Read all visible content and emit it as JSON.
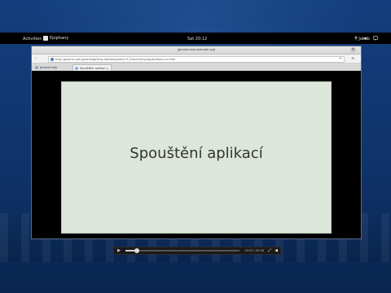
{
  "topbar": {
    "activities_label": "Activities",
    "app_name": "Epiphany",
    "clock": "Sat 20:12",
    "user_name": "Jakub"
  },
  "window": {
    "title": "(gnome-help example org)"
  },
  "browser": {
    "url": "http://gnome.com/gnome/getting-started/gnome-3.2/launching-applications-cs.html",
    "tabs": [
      {
        "label": "gnome-help"
      },
      {
        "label": "Spouštění aplikací"
      }
    ]
  },
  "video": {
    "heading": "Spouštění aplikací",
    "time": "00:03 / 00:58",
    "progress": 0.1
  }
}
